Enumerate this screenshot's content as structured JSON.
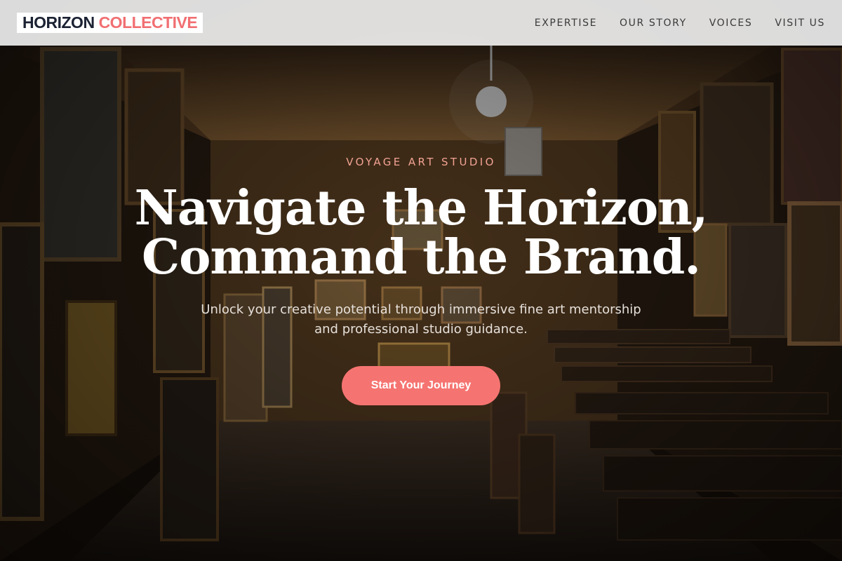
{
  "header": {
    "logo": {
      "primary": "HORIZON",
      "accent": "COLLECTIVE"
    },
    "nav": [
      {
        "label": "EXPERTISE"
      },
      {
        "label": "OUR STORY"
      },
      {
        "label": "VOICES"
      },
      {
        "label": "VISIT US"
      }
    ]
  },
  "hero": {
    "eyebrow": "VOYAGE ART STUDIO",
    "headline_line1": "Navigate the Horizon,",
    "headline_line2": "Command the Brand.",
    "subtext_line1": "Unlock your creative potential through immersive fine art mentorship",
    "subtext_line2": "and professional studio guidance.",
    "cta_label": "Start Your Journey"
  },
  "colors": {
    "accent": "#f57471",
    "logo_dark": "#1b2233",
    "eyebrow": "#f2a292"
  }
}
